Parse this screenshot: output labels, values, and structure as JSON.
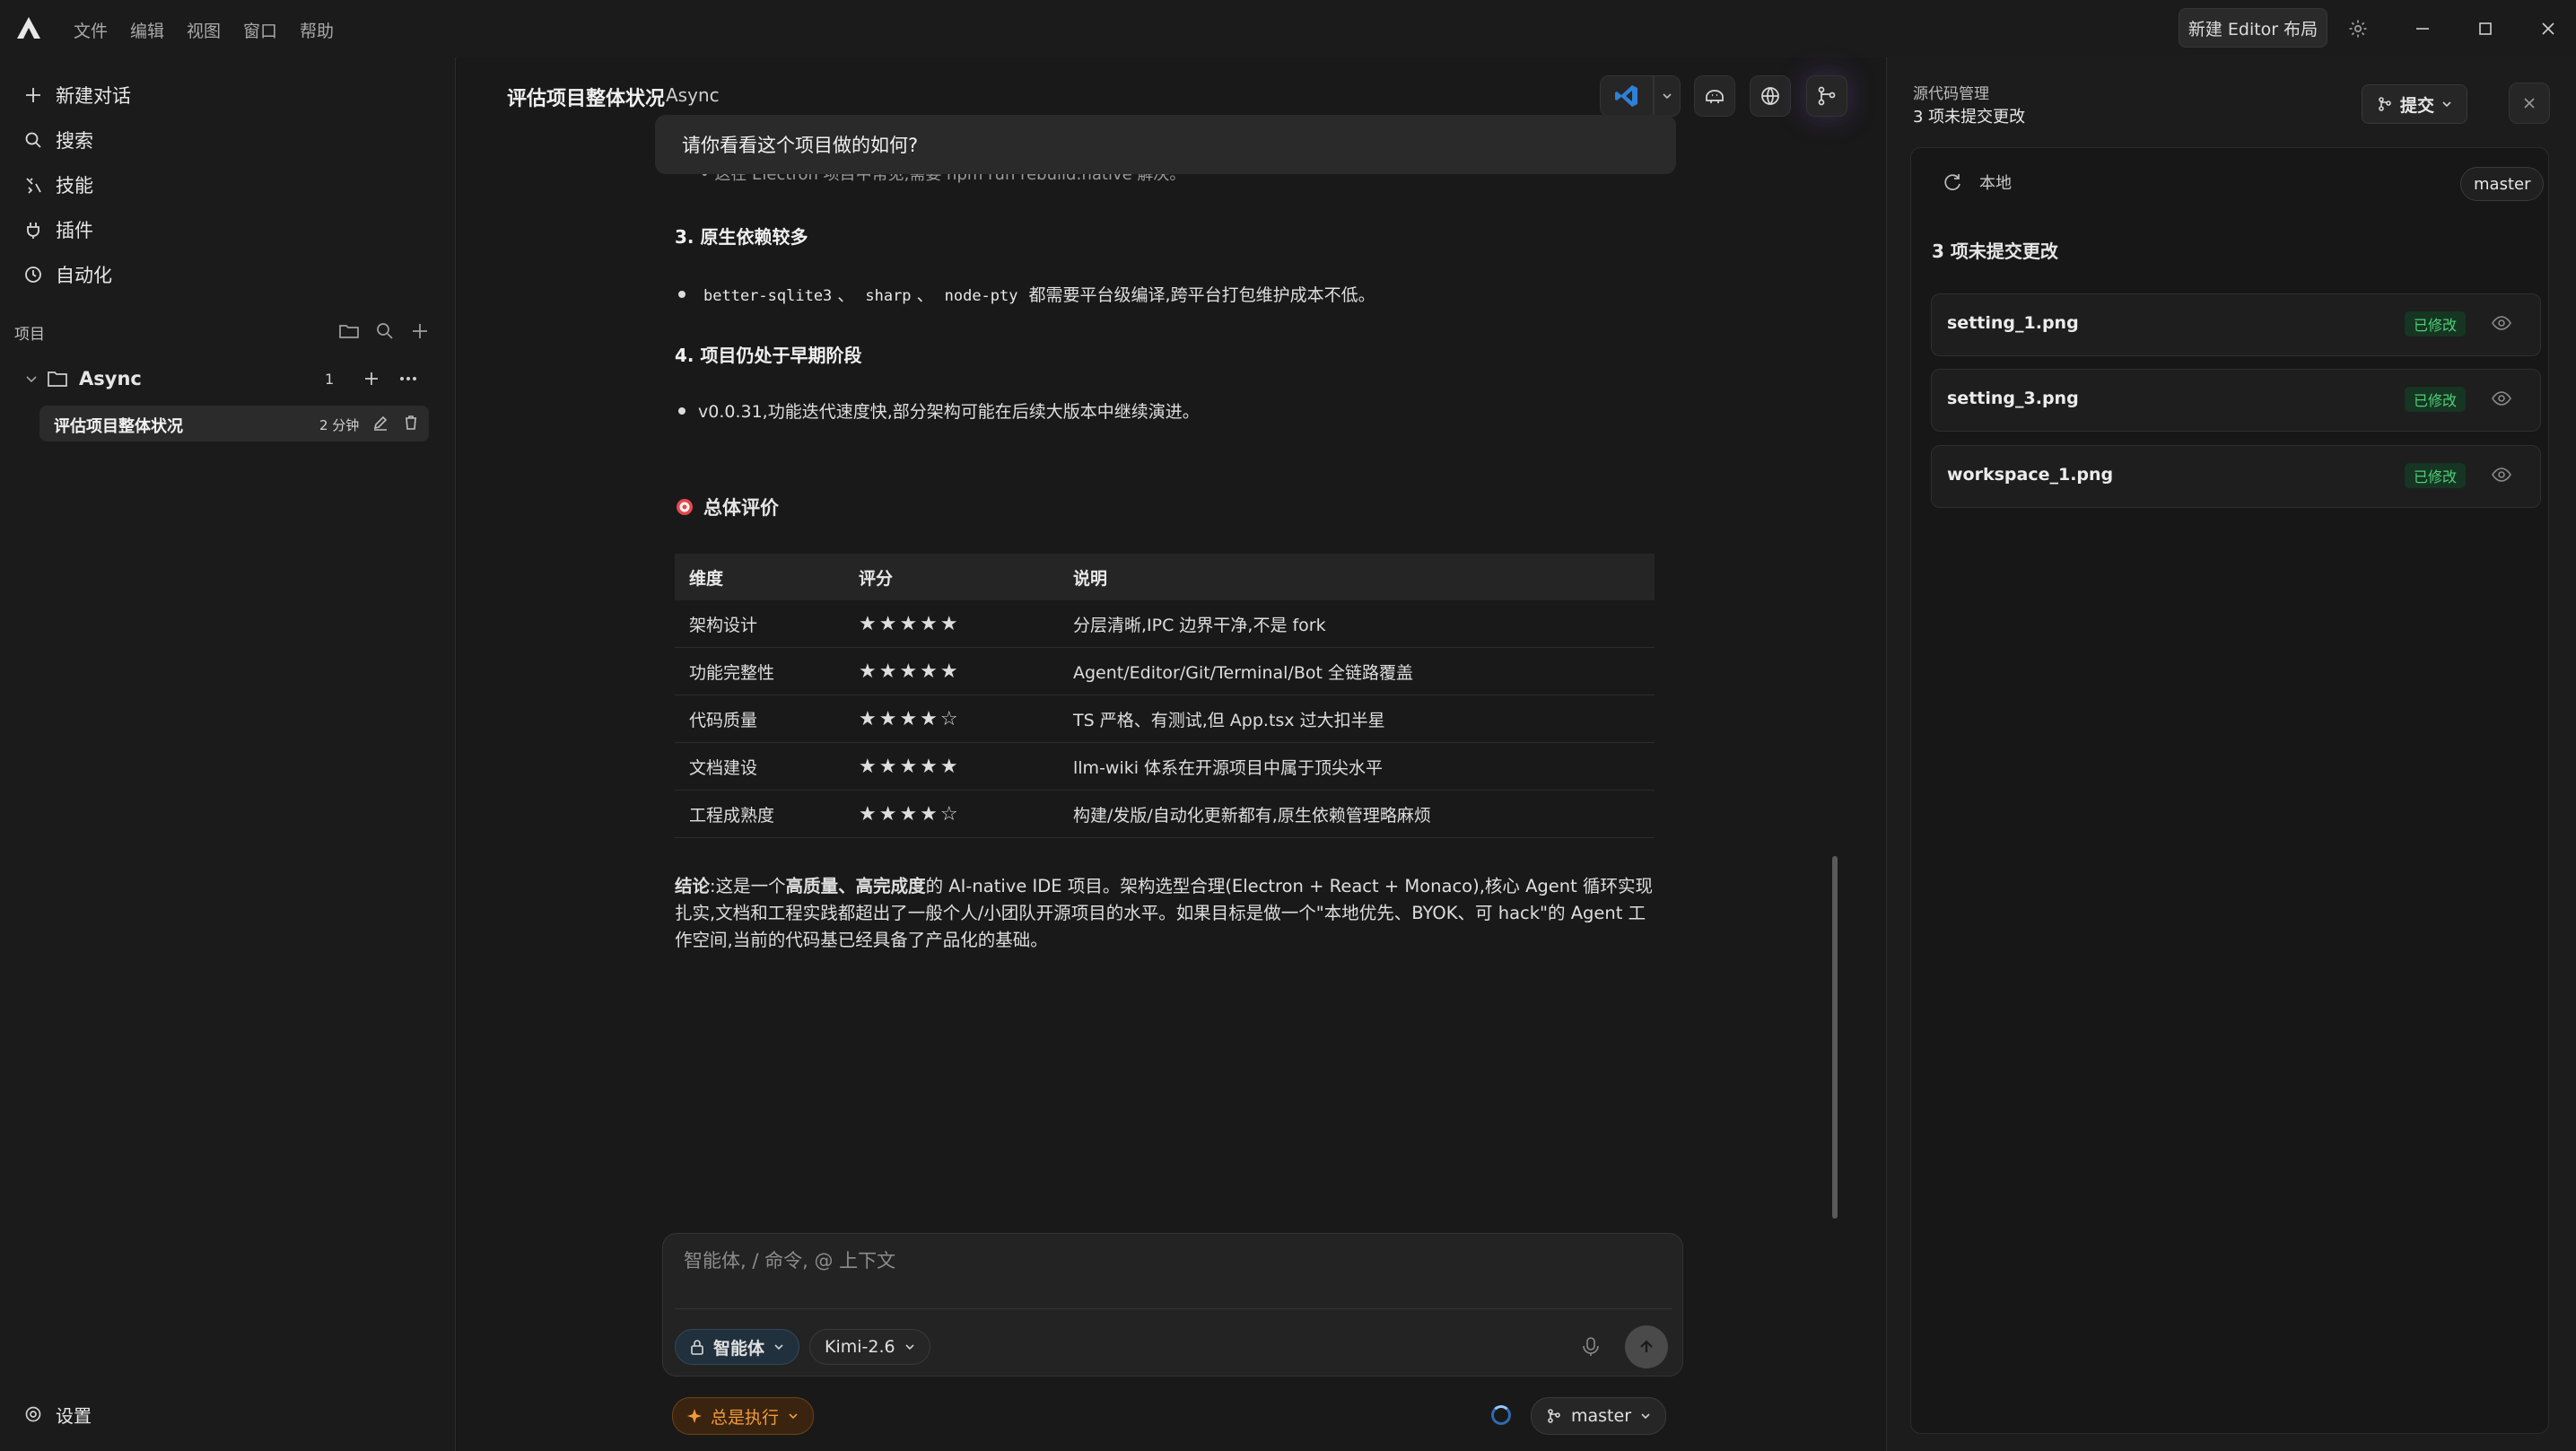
{
  "titlebar": {
    "menu": [
      "文件",
      "编辑",
      "视图",
      "窗口",
      "帮助"
    ],
    "new_layout_label": "新建 Editor 布局"
  },
  "sidebar": {
    "nav": [
      {
        "label": "新建对话",
        "icon": "plus-icon"
      },
      {
        "label": "搜索",
        "icon": "search-icon"
      },
      {
        "label": "技能",
        "icon": "skills-icon"
      },
      {
        "label": "插件",
        "icon": "plugin-icon"
      },
      {
        "label": "自动化",
        "icon": "clock-icon"
      }
    ],
    "projects_label": "项目",
    "project": {
      "name": "Async",
      "count": "1"
    },
    "task": {
      "title": "评估项目整体状况",
      "time": "2 分钟"
    },
    "settings_label": "设置"
  },
  "conversation": {
    "title": "评估项目整体状况",
    "project": "Async",
    "user_message": "请你看看这个项目做的如何?",
    "clipped_text": "• 这在 Electron 项目中常见,需要 npm run rebuild:native 解决。",
    "sections": [
      {
        "heading": "3. 原生依赖较多",
        "parts": [
          {
            "t": "better-sqlite3",
            "mono": true
          },
          {
            "t": "、"
          },
          {
            "t": "sharp",
            "mono": true
          },
          {
            "t": "、"
          },
          {
            "t": "node-pty",
            "mono": true
          },
          {
            "t": "都需要平台级编译,跨平台打包维护成本不低。"
          }
        ]
      },
      {
        "heading": "4. 项目仍处于早期阶段",
        "parts": [
          {
            "t": "v0.0.31,功能迭代速度快,部分架构可能在后续大版本中继续演进。"
          }
        ]
      }
    ],
    "overall_heading": "总体评价",
    "table": {
      "headers": [
        "维度",
        "评分",
        "说明"
      ],
      "rows": [
        [
          "架构设计",
          "★★★★★",
          "分层清晰,IPC 边界干净,不是 fork"
        ],
        [
          "功能完整性",
          "★★★★★",
          "Agent/Editor/Git/Terminal/Bot 全链路覆盖"
        ],
        [
          "代码质量",
          "★★★★☆",
          "TS 严格、有测试,但 App.tsx 过大扣半星"
        ],
        [
          "文档建设",
          "★★★★★",
          "llm-wiki 体系在开源项目中属于顶尖水平"
        ],
        [
          "工程成熟度",
          "★★★★☆",
          "构建/发版/自动化更新都有,原生依赖管理略麻烦"
        ]
      ]
    },
    "conclusion": {
      "label": "结论",
      "p1": ":这是一个",
      "b1": "高质量、高完成度",
      "p2": "的 AI-native IDE 项目。架构选型合理(Electron + React + Monaco),核心 Agent 循环实现扎实,文档和工程实践都超出了一般个人/小团队开源项目的水平。如果目标是做一个\"本地优先、BYOK、可 hack\"的 Agent 工作空间,当前的代码基已经具备了产品化的基础。"
    }
  },
  "composer": {
    "placeholder": "智能体, / 命令, @ 上下文",
    "mode": "智能体",
    "model": "Kimi-2.6",
    "exec_mode": "总是执行",
    "branch": "master"
  },
  "source_control": {
    "title": "源代码管理",
    "subtitle": "3 项未提交更改",
    "commit_label": "提交",
    "local_label": "本地",
    "branch": "master",
    "changes_heading": "3 项未提交更改",
    "files": [
      {
        "name": "setting_1.png",
        "status": "已修改"
      },
      {
        "name": "setting_3.png",
        "status": "已修改"
      },
      {
        "name": "workspace_1.png",
        "status": "已修改"
      }
    ]
  },
  "colors": {
    "accent_blue": "#2f80d6",
    "star": "#f5c12e",
    "modified_badge": "#4fcf78",
    "exec_orange": "#f09a3b"
  }
}
